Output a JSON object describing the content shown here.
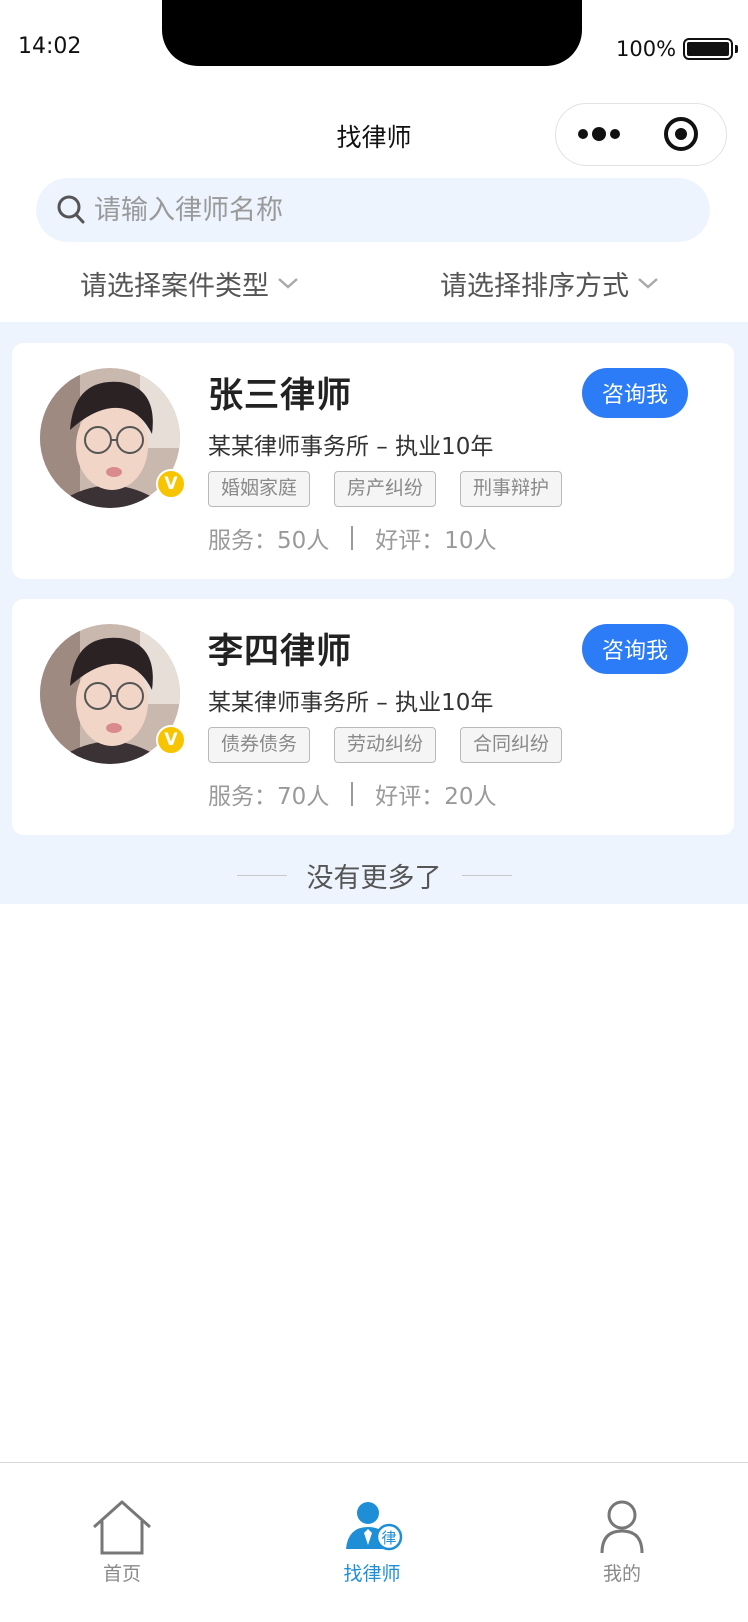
{
  "status_bar": {
    "time": "14:02",
    "battery": "100%"
  },
  "nav": {
    "title": "找律师"
  },
  "search": {
    "placeholder": "请输入律师名称"
  },
  "filters": {
    "case_type": "请选择案件类型",
    "sort": "请选择排序方式"
  },
  "lawyers": [
    {
      "name": "张三律师",
      "consult_label": "咨询我",
      "firm": "某某律师事务所 – 执业10年",
      "tags": [
        "婚姻家庭",
        "房产纠纷",
        "刑事辩护"
      ],
      "served": "服务：50人",
      "rating": "好评：10人"
    },
    {
      "name": "李四律师",
      "consult_label": "咨询我",
      "firm": "某某律师事务所 – 执业10年",
      "tags": [
        "债券债务",
        "劳动纠纷",
        "合同纠纷"
      ],
      "served": "服务：70人",
      "rating": "好评：20人"
    }
  ],
  "verified_badge": "V",
  "list_end": "没有更多了",
  "tabbar": {
    "home": "首页",
    "lawyer": "找律师",
    "lawyer_badge": "律",
    "mine": "我的"
  },
  "colors": {
    "accent": "#2b7cf6",
    "tab_active": "#1e8fd6",
    "list_bg": "#eef4fe",
    "verified": "#f7c400"
  }
}
